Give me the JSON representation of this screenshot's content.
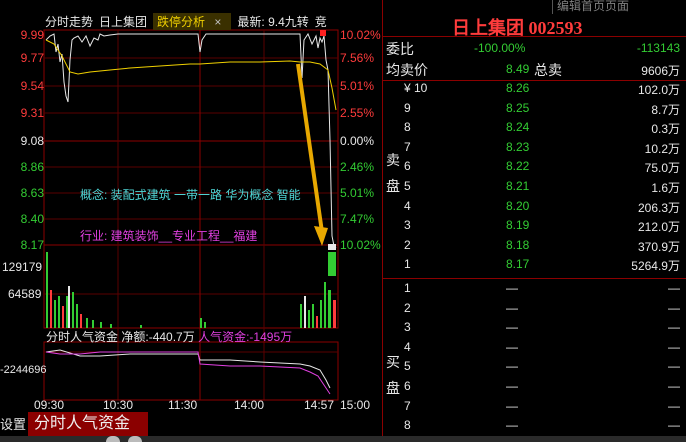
{
  "top_menu": {
    "label": "编辑首页页面"
  },
  "chart": {
    "tabs": {
      "t1": "分时走势",
      "t2": "日上集团",
      "t3": "跌停分析",
      "close": "×",
      "t4": "最新: 9.4九转",
      "t5": "竞"
    },
    "left_prices": [
      "9.99",
      "9.77",
      "9.54",
      "9.31",
      "9.08",
      "8.86",
      "8.63",
      "8.40",
      "8.17"
    ],
    "right_pcts": [
      "10.02%",
      "7.56%",
      "5.01%",
      "2.55%",
      "0.00%",
      "2.46%",
      "5.01%",
      "7.47%",
      "10.02%"
    ],
    "volume_labels": [
      "129179",
      "64589"
    ],
    "concept_text": "概念: 装配式建筑  一带一路  华为概念  智能",
    "industry_text": "行业: 建筑装饰__专业工程__福建",
    "capital_header": {
      "title": "分时人气资金",
      "net_label": "净额:",
      "net_value": "-440.7万",
      "popularity_label": "人气资金:",
      "popularity_value": "-1495万"
    },
    "capital_left_label": "-2244696",
    "time_labels": [
      "09:30",
      "10:30",
      "11:30",
      "14:00",
      "14:57",
      "15:00"
    ],
    "bottom_tabs": {
      "t1": "设置",
      "t2": "分时人气资金"
    }
  },
  "book": {
    "title": "日上集团 002593",
    "weibi": {
      "label": "委比",
      "pct": "-100.00%",
      "diff": "-113143"
    },
    "avg": {
      "label": "均卖价",
      "price": "8.49",
      "label2": "总卖",
      "qty": "9606万"
    },
    "sell_side_label": [
      "卖",
      "盘"
    ],
    "sell": [
      {
        "level": "¥ 10",
        "price": "8.26",
        "qty": "102.0万"
      },
      {
        "level": "9",
        "price": "8.25",
        "qty": "8.7万"
      },
      {
        "level": "8",
        "price": "8.24",
        "qty": "0.3万"
      },
      {
        "level": "7",
        "price": "8.23",
        "qty": "10.2万"
      },
      {
        "level": "6",
        "price": "8.22",
        "qty": "75.0万"
      },
      {
        "level": "5",
        "price": "8.21",
        "qty": "1.6万"
      },
      {
        "level": "4",
        "price": "8.20",
        "qty": "206.3万"
      },
      {
        "level": "3",
        "price": "8.19",
        "qty": "212.0万"
      },
      {
        "level": "2",
        "price": "8.18",
        "qty": "370.9万"
      },
      {
        "level": "1",
        "price": "8.17",
        "qty": "5264.9万"
      }
    ],
    "buy_side_label": [
      "买",
      "盘"
    ],
    "buy": [
      {
        "level": "1",
        "price": "—",
        "qty": "—"
      },
      {
        "level": "2",
        "price": "—",
        "qty": "—"
      },
      {
        "level": "3",
        "price": "—",
        "qty": "—"
      },
      {
        "level": "4",
        "price": "—",
        "qty": "—"
      },
      {
        "level": "5",
        "price": "—",
        "qty": "—"
      },
      {
        "level": "6",
        "price": "—",
        "qty": "—"
      },
      {
        "level": "7",
        "price": "—",
        "qty": "—"
      },
      {
        "level": "8",
        "price": "—",
        "qty": "—"
      }
    ]
  }
}
